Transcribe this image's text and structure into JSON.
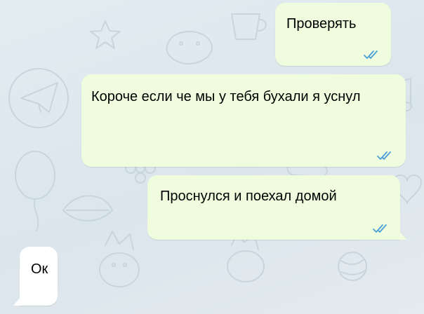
{
  "colors": {
    "outgoing_bubble": "#effdde",
    "incoming_bubble": "#ffffff",
    "read_checks": "#4fae4e"
  },
  "messages": [
    {
      "direction": "out",
      "text": "Проверять",
      "status_icon": "double-check-icon"
    },
    {
      "direction": "out",
      "text": "Короче если че мы у тебя бухали я уснул",
      "status_icon": "double-check-icon"
    },
    {
      "direction": "out",
      "text": "Проснулся и поехал домой",
      "status_icon": "double-check-icon"
    },
    {
      "direction": "in",
      "text": "Ок"
    }
  ]
}
